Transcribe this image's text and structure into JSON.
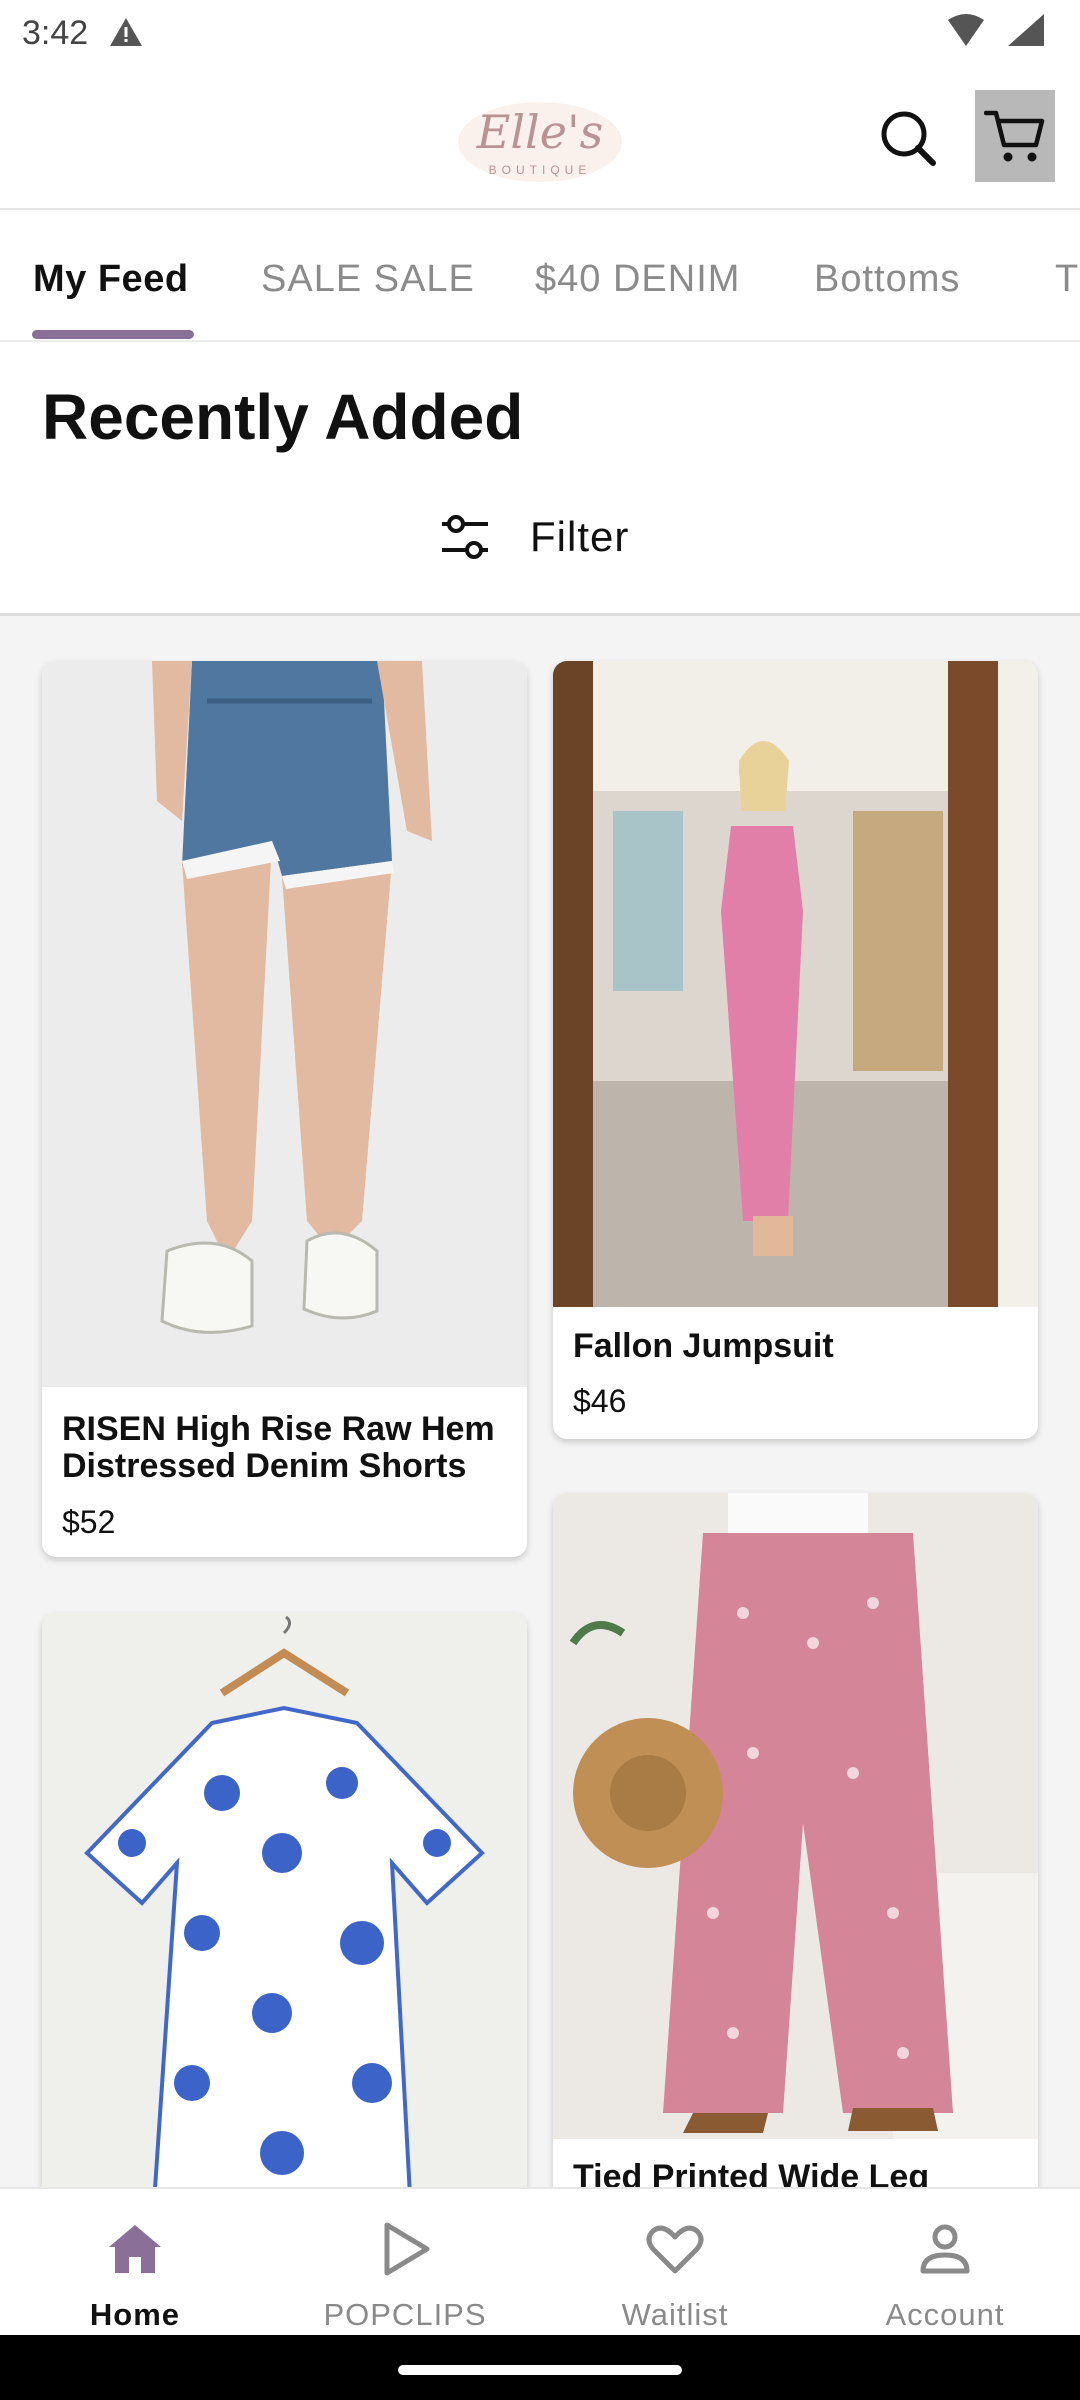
{
  "status_bar": {
    "time": "3:42"
  },
  "header": {
    "brand_name": "Elle's",
    "brand_sub": "BOUTIQUE",
    "accent_color": "#8a7099"
  },
  "tabs": [
    {
      "label": "My Feed",
      "active": true
    },
    {
      "label": "SALE SALE"
    },
    {
      "label": "$40 DENIM"
    },
    {
      "label": "Bottoms"
    },
    {
      "label": "T"
    }
  ],
  "section": {
    "title": "Recently Added",
    "filter_label": "Filter"
  },
  "products": [
    {
      "title_line1": "RISEN High Rise Raw Hem",
      "title_line2": "Distressed Denim Shorts",
      "price": "$52"
    },
    {
      "title": "Fallon Jumpsuit",
      "price": "$46"
    },
    {
      "title": "Tied Printed Wide Leg"
    },
    {
      "title": ""
    }
  ],
  "bottom_nav": [
    {
      "label": "Home",
      "icon": "home-icon",
      "active": true
    },
    {
      "label": "POPCLIPS",
      "icon": "play-icon"
    },
    {
      "label": "Waitlist",
      "icon": "heart-icon"
    },
    {
      "label": "Account",
      "icon": "person-icon"
    }
  ]
}
